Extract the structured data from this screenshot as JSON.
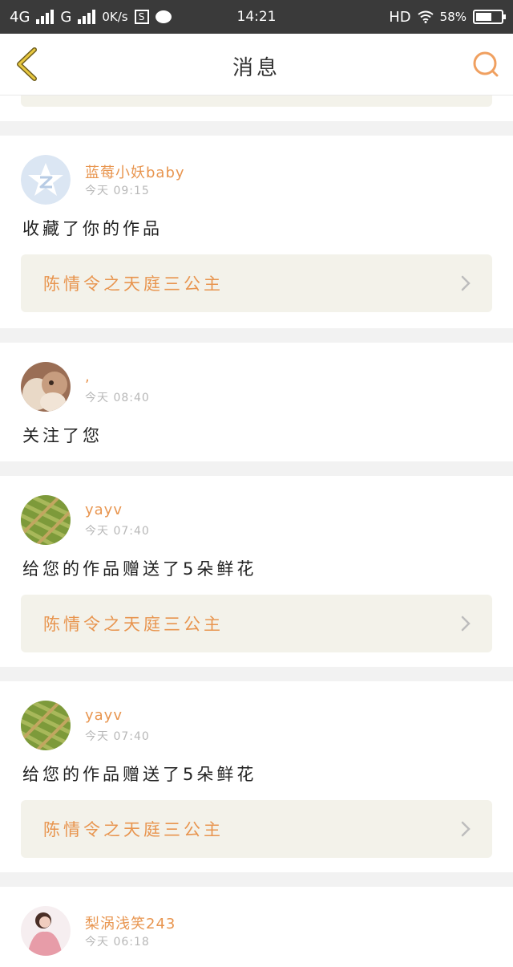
{
  "status_bar": {
    "network_1": "4G",
    "network_2": "G",
    "speed": "0K/s",
    "s_icon_letter": "S",
    "time": "14:21",
    "hd": "HD",
    "battery": "58%"
  },
  "nav": {
    "title": "消息",
    "icons": {
      "back": "chevron-left-icon",
      "search": "search-icon"
    },
    "accent_color": "#f0a060"
  },
  "messages": [
    {
      "user": "蓝莓小妖baby",
      "time": "今天 09:15",
      "action": "收藏了你的作品",
      "work": "陈情令之天庭三公主",
      "avatar": "default-star-avatar"
    },
    {
      "user": ",",
      "time": "今天 08:40",
      "action": "关注了您",
      "work": null,
      "avatar": "cat-photo-avatar"
    },
    {
      "user": "yayv",
      "time": "今天 07:40",
      "action": "给您的作品赠送了5朵鲜花",
      "work": "陈情令之天庭三公主",
      "avatar": "green-texture-avatar"
    },
    {
      "user": "yayv",
      "time": "今天 07:40",
      "action": "给您的作品赠送了5朵鲜花",
      "work": "陈情令之天庭三公主",
      "avatar": "green-texture-avatar"
    },
    {
      "user": "梨涡浅笑243",
      "time": "今天 06:18",
      "action": null,
      "work": null,
      "avatar": "girl-photo-avatar"
    }
  ]
}
